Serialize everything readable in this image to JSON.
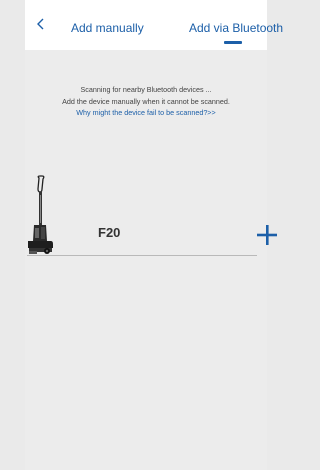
{
  "header": {
    "back_icon": "chevron-left-icon",
    "tab_manual": "Add manually",
    "tab_bluetooth": "Add via Bluetooth",
    "active_tab": "Add via Bluetooth",
    "accent_color": "#1c5fa8"
  },
  "scan": {
    "line1": "Scanning for nearby Bluetooth devices ...",
    "line2": "Add the device manually when it cannot be scanned.",
    "help_link": "Why might the device fail to be scanned?>>"
  },
  "devices": [
    {
      "name": "F20",
      "image_icon": "vacuum-cleaner-icon",
      "action_icon": "plus-icon"
    }
  ]
}
